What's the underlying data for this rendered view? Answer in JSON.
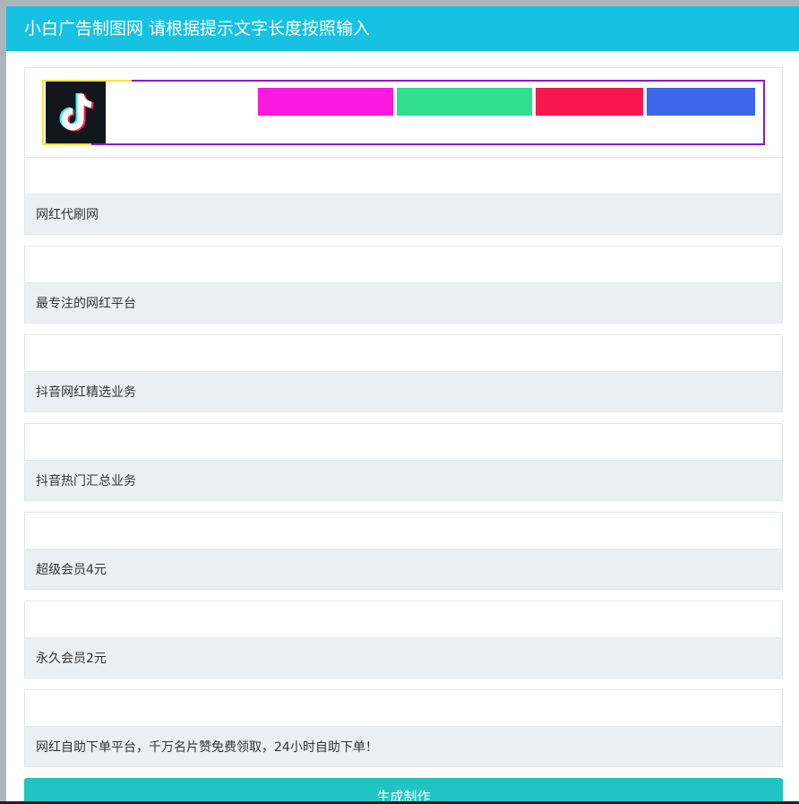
{
  "panel": {
    "title": "小白广告制图网 请根据提示文字长度按照输入"
  },
  "preview": {
    "logo_icon": "tiktok-logo-icon",
    "colors": {
      "header": "#17c1e2",
      "banner_border": "#8a1ad6",
      "banner_accent": "#f4e53a",
      "block_1": "#fa19de",
      "block_2": "#2fde8f",
      "block_3": "#f8174e",
      "block_4": "#3b66e9",
      "submit": "#20c4c2"
    }
  },
  "fields": [
    {
      "value": "网红代刷网"
    },
    {
      "value": "最专注的网红平台"
    },
    {
      "value": "抖音网红精选业务"
    },
    {
      "value": "抖音热门汇总业务"
    },
    {
      "value": "超级会员4元"
    },
    {
      "value": "永久会员2元"
    },
    {
      "value": "网红自助下单平台，千万名片赞免费领取，24小时自助下单！"
    }
  ],
  "submit": {
    "label": "生成制作"
  }
}
